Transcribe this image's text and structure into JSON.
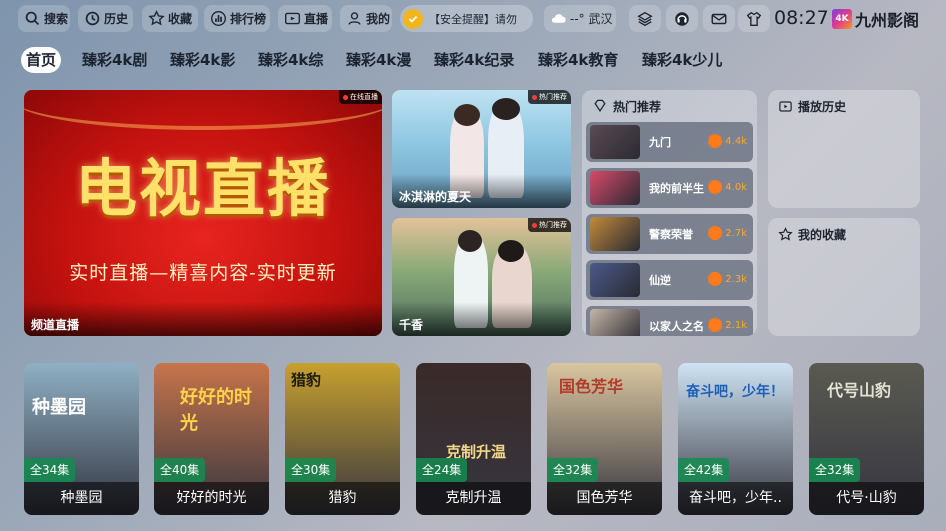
{
  "topbar": {
    "search": "搜索",
    "history": "历史",
    "favorites": "收藏",
    "ranking": "排行榜",
    "live": "直播",
    "mine": "我的",
    "notice": "【安全提醒】请勿",
    "weather": "--° 武汉",
    "time": "08:27",
    "brand_badge": "4K",
    "brand_name": "九州影阁"
  },
  "tabs": [
    {
      "label": "首页",
      "active": true
    },
    {
      "label": "臻彩4k剧"
    },
    {
      "label": "臻彩4k影"
    },
    {
      "label": "臻彩4k综"
    },
    {
      "label": "臻彩4k漫"
    },
    {
      "label": "臻彩4k纪录"
    },
    {
      "label": "臻彩4k教育"
    },
    {
      "label": "臻彩4k少儿"
    }
  ],
  "live_banner": {
    "badge": "在线直播",
    "headline": "电视直播",
    "subline": "实时直播—精喜内容-实时更新",
    "caption": "频道直播"
  },
  "featured": [
    {
      "title": "冰淇淋的夏天",
      "badge": "热门推荐"
    },
    {
      "title": "千香",
      "badge": "热门推荐"
    }
  ],
  "hot": {
    "title": "热门推荐",
    "items": [
      {
        "title": "九门",
        "heat": "4.4k",
        "color": "#5b4a52"
      },
      {
        "title": "我的前半生",
        "heat": "4.0k",
        "color": "#d84a6a"
      },
      {
        "title": "警察荣誉",
        "heat": "2.7k",
        "color": "#c38a3a"
      },
      {
        "title": "仙逆",
        "heat": "2.3k",
        "color": "#4a5a8a"
      },
      {
        "title": "以家人之名",
        "heat": "2.1k",
        "color": "#c6b6a6"
      }
    ]
  },
  "history_panel": {
    "title": "播放历史"
  },
  "favorites_panel": {
    "title": "我的收藏"
  },
  "posters": [
    {
      "title": "种墨园",
      "episodes": "全34集",
      "art": "种墨园",
      "bg": "#8fb0c4"
    },
    {
      "title": "好好的时光",
      "episodes": "全40集",
      "art": "好好的时光",
      "bg": "#c7744a"
    },
    {
      "title": "猎豹",
      "episodes": "全30集",
      "art": "猎豹",
      "bg": "#c7a02e"
    },
    {
      "title": "克制升温",
      "episodes": "全24集",
      "art": "克制升温",
      "bg": "#3a2a28"
    },
    {
      "title": "国色芳华",
      "episodes": "全32集",
      "art": "国色芳华",
      "bg": "#d9c6a0"
    },
    {
      "title": "奋斗吧，少年..",
      "episodes": "全42集",
      "art": "奋斗吧，少年！",
      "bg": "#cfe3f2"
    },
    {
      "title": "代号·山豹",
      "episodes": "全32集",
      "art": "代号山豹",
      "bg": "#5a5a52"
    }
  ]
}
